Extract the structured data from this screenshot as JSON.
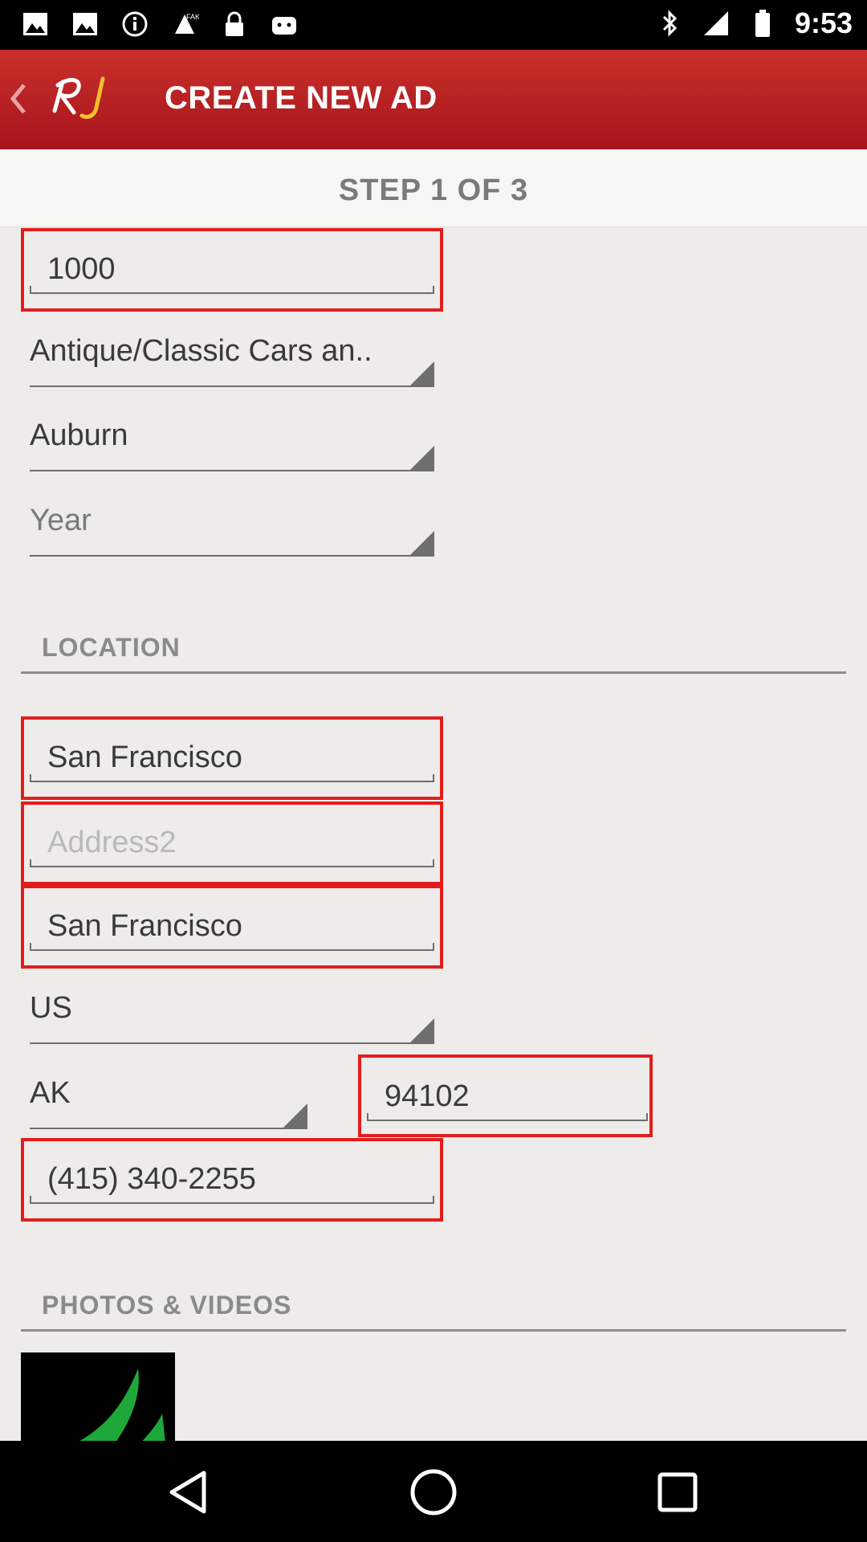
{
  "status_bar": {
    "time": "9:53",
    "left_icons": [
      "image-icon",
      "image-icon",
      "info-icon",
      "fake-gps-icon",
      "lock-icon",
      "android-icon"
    ],
    "right_icons": [
      "bluetooth-icon",
      "signal-icon",
      "battery-icon"
    ]
  },
  "app_bar": {
    "title": "CREATE NEW AD",
    "logo_text": "RJ"
  },
  "step": {
    "label": "STEP 1 OF 3"
  },
  "form": {
    "price": "1000",
    "category": "Antique/Classic Cars an..",
    "make": "Auburn",
    "year_placeholder": "Year"
  },
  "location": {
    "header": "LOCATION",
    "address1": "San Francisco",
    "address2_placeholder": "Address2",
    "city": "San Francisco",
    "country": "US",
    "state": "AK",
    "zip": "94102",
    "phone": "(415) 340-2255"
  },
  "photos": {
    "header": "PHOTOS & VIDEOS"
  },
  "colors": {
    "app_bar": "#b01d22",
    "highlight_border": "#e31d1d",
    "background": "#edecea"
  }
}
